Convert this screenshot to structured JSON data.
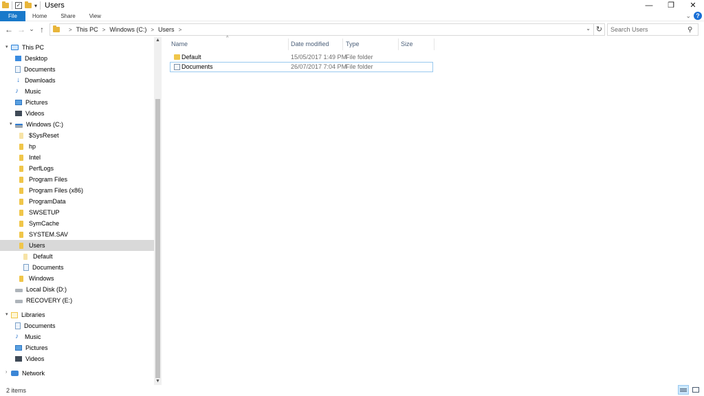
{
  "window": {
    "title": "Users",
    "minimize": "—",
    "restore": "❐",
    "close": "✕"
  },
  "quick_access": {
    "check": "✓",
    "dropdown": "▾"
  },
  "ribbon": {
    "tabs": [
      "File",
      "Home",
      "Share",
      "View"
    ],
    "expand": "⌄",
    "help": "?"
  },
  "nav": {
    "back": "←",
    "forward": "→",
    "recent": "⌄",
    "up": "↑",
    "breadcrumb": [
      "This PC",
      "Windows (C:)",
      "Users"
    ],
    "crumb_sep": ">",
    "dropdown": "⌄",
    "refresh": "↻"
  },
  "search": {
    "placeholder": "Search Users",
    "icon": "⚲"
  },
  "sidebar": {
    "items": [
      {
        "label": "This PC",
        "icon": "pc-icon"
      },
      {
        "label": "Desktop",
        "icon": "desktop-icon"
      },
      {
        "label": "Documents",
        "icon": "documents-icon"
      },
      {
        "label": "Downloads",
        "icon": "downloads-icon"
      },
      {
        "label": "Music",
        "icon": "music-icon"
      },
      {
        "label": "Pictures",
        "icon": "pictures-icon"
      },
      {
        "label": "Videos",
        "icon": "videos-icon"
      },
      {
        "label": "Windows (C:)",
        "icon": "windows-drive-icon"
      },
      {
        "label": "$SysReset",
        "icon": "folder-icon"
      },
      {
        "label": "hp",
        "icon": "folder-icon"
      },
      {
        "label": "Intel",
        "icon": "folder-icon"
      },
      {
        "label": "PerfLogs",
        "icon": "folder-icon"
      },
      {
        "label": "Program Files",
        "icon": "folder-icon"
      },
      {
        "label": "Program Files (x86)",
        "icon": "folder-icon"
      },
      {
        "label": "ProgramData",
        "icon": "folder-icon"
      },
      {
        "label": "SWSETUP",
        "icon": "folder-icon"
      },
      {
        "label": "SymCache",
        "icon": "folder-icon"
      },
      {
        "label": "SYSTEM.SAV",
        "icon": "folder-icon"
      },
      {
        "label": "Users",
        "icon": "folder-icon",
        "selected": true
      },
      {
        "label": "Default",
        "icon": "folder-icon"
      },
      {
        "label": "Documents",
        "icon": "documents-icon"
      },
      {
        "label": "Windows",
        "icon": "folder-icon"
      },
      {
        "label": "Local Disk (D:)",
        "icon": "drive-icon"
      },
      {
        "label": "RECOVERY (E:)",
        "icon": "drive-icon"
      },
      {
        "label": "Libraries",
        "icon": "libraries-icon"
      },
      {
        "label": "Documents",
        "icon": "documents-icon"
      },
      {
        "label": "Music",
        "icon": "music-icon"
      },
      {
        "label": "Pictures",
        "icon": "pictures-icon"
      },
      {
        "label": "Videos",
        "icon": "videos-icon"
      },
      {
        "label": "Network",
        "icon": "network-icon"
      }
    ],
    "scroll_up": "▲",
    "scroll_down": "▼"
  },
  "file_list": {
    "columns": {
      "name": "Name",
      "date": "Date modified",
      "type": "Type",
      "size": "Size"
    },
    "sort_indicator": "^",
    "rows": [
      {
        "name": "Default",
        "date": "15/05/2017 1:49 PM",
        "type": "File folder",
        "size": "",
        "icon": "folder-icon"
      },
      {
        "name": "Documents",
        "date": "26/07/2017 7:04 PM",
        "type": "File folder",
        "size": "",
        "icon": "documents-folder-icon"
      }
    ]
  },
  "status_bar": {
    "item_count": "2 items"
  }
}
